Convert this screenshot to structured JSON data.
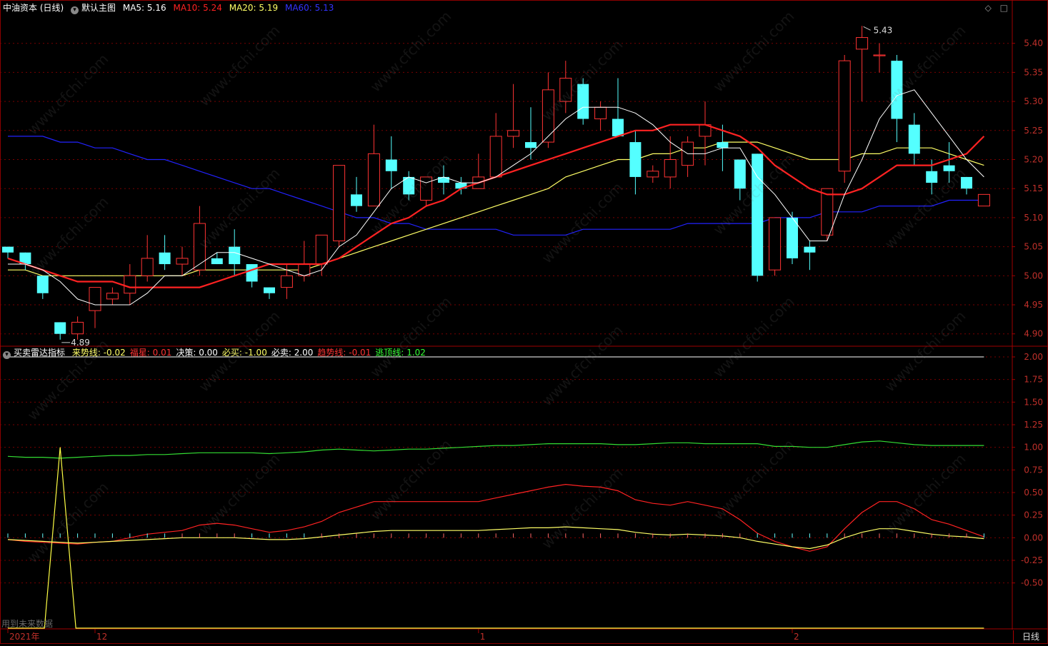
{
  "main_header": {
    "stock": "中油资本 (日线)",
    "template": "默认主图",
    "ma5": "MA5: 5.16",
    "ma10": "MA10: 5.24",
    "ma20": "MA20: 5.19",
    "ma60": "MA60: 5.13"
  },
  "indicator_header": {
    "name": "买卖雷达指标",
    "items": [
      {
        "text": "来势线: -0.02",
        "color": "#ffff66"
      },
      {
        "text": "福星: 0.01",
        "color": "#ff3333"
      },
      {
        "text": "决策: 0.00",
        "color": "#ffffff"
      },
      {
        "text": "必买: -1.00",
        "color": "#ffff66"
      },
      {
        "text": "必卖: 2.00",
        "color": "#ffffff"
      },
      {
        "text": "趋势线: -0.01",
        "color": "#ff3333"
      },
      {
        "text": "逃顶线: 1.02",
        "color": "#33ff33"
      }
    ]
  },
  "top_icons": [
    "diamond-icon",
    "square-icon"
  ],
  "watermark": "www.cfchi.com",
  "future_note": "用到未来数据",
  "period_button": "日线",
  "x_labels": [
    {
      "text": "2021年",
      "idx": 0
    },
    {
      "text": "12",
      "idx": 5
    },
    {
      "text": "1",
      "idx": 27
    },
    {
      "text": "2",
      "idx": 45
    }
  ],
  "price_axis": {
    "ticks": [
      5.4,
      5.35,
      5.3,
      5.25,
      5.2,
      5.15,
      5.1,
      5.05,
      5.0,
      4.95,
      4.9
    ],
    "min": 4.88,
    "max": 5.45
  },
  "ind_axis": {
    "ticks": [
      "2.00",
      "1.75",
      "1.50",
      "1.25",
      "1.00",
      "0.75",
      "0.50",
      "0.25",
      "0.00",
      "-0.25",
      "-0.50"
    ],
    "min": -1.0,
    "max": 2.0
  },
  "annotations": {
    "high": "5.43",
    "low": "4.89"
  },
  "colors": {
    "up": "#ff3333",
    "down": "#54ffff",
    "ma5": "#ffffff",
    "ma10": "#ff2222",
    "ma20": "#ffff66",
    "ma60": "#2222ff",
    "grid": "#7a0000"
  },
  "chart_data": {
    "type": "candlestick",
    "candles": [
      [
        5.05,
        5.04,
        5.05,
        5.03
      ],
      [
        5.04,
        5.02,
        5.04,
        5.01
      ],
      [
        5.0,
        4.97,
        5.0,
        4.96
      ],
      [
        4.92,
        4.9,
        4.92,
        4.89
      ],
      [
        4.9,
        4.92,
        4.93,
        4.89
      ],
      [
        4.94,
        4.98,
        4.98,
        4.91
      ],
      [
        4.96,
        4.97,
        4.98,
        4.95
      ],
      [
        4.97,
        5.0,
        5.02,
        4.95
      ],
      [
        5.0,
        5.03,
        5.07,
        4.99
      ],
      [
        5.04,
        5.02,
        5.07,
        5.01
      ],
      [
        5.02,
        5.03,
        5.05,
        5.0
      ],
      [
        5.01,
        5.09,
        5.12,
        5.0
      ],
      [
        5.03,
        5.02,
        5.04,
        5.02
      ],
      [
        5.05,
        5.02,
        5.08,
        5.0
      ],
      [
        5.02,
        4.99,
        5.02,
        4.98
      ],
      [
        4.98,
        4.97,
        4.98,
        4.96
      ],
      [
        4.98,
        5.0,
        5.02,
        4.96
      ],
      [
        5.0,
        5.02,
        5.06,
        4.99
      ],
      [
        5.02,
        5.07,
        5.07,
        5.0
      ],
      [
        5.06,
        5.19,
        5.19,
        5.05
      ],
      [
        5.14,
        5.12,
        5.17,
        5.11
      ],
      [
        5.12,
        5.21,
        5.26,
        5.12
      ],
      [
        5.2,
        5.18,
        5.24,
        5.15
      ],
      [
        5.17,
        5.14,
        5.18,
        5.13
      ],
      [
        5.13,
        5.17,
        5.17,
        5.12
      ],
      [
        5.17,
        5.16,
        5.19,
        5.14
      ],
      [
        5.16,
        5.15,
        5.17,
        5.14
      ],
      [
        5.15,
        5.17,
        5.21,
        5.15
      ],
      [
        5.17,
        5.24,
        5.28,
        5.2
      ],
      [
        5.24,
        5.25,
        5.33,
        5.22
      ],
      [
        5.23,
        5.22,
        5.29,
        5.2
      ],
      [
        5.23,
        5.32,
        5.35,
        5.22
      ],
      [
        5.3,
        5.34,
        5.37,
        5.28
      ],
      [
        5.33,
        5.27,
        5.34,
        5.26
      ],
      [
        5.27,
        5.29,
        5.3,
        5.25
      ],
      [
        5.27,
        5.24,
        5.34,
        5.24
      ],
      [
        5.23,
        5.17,
        5.25,
        5.14
      ],
      [
        5.17,
        5.18,
        5.19,
        5.16
      ],
      [
        5.17,
        5.2,
        5.24,
        5.15
      ],
      [
        5.19,
        5.23,
        5.24,
        5.17
      ],
      [
        5.24,
        5.26,
        5.3,
        5.19
      ],
      [
        5.23,
        5.22,
        5.26,
        5.18
      ],
      [
        5.2,
        5.15,
        5.2,
        5.13
      ],
      [
        5.21,
        5.0,
        5.21,
        4.99
      ],
      [
        5.01,
        5.1,
        5.1,
        5.0
      ],
      [
        5.1,
        5.03,
        5.11,
        5.02
      ],
      [
        5.05,
        5.04,
        5.06,
        5.01
      ],
      [
        5.07,
        5.15,
        5.15,
        5.06
      ],
      [
        5.18,
        5.37,
        5.38,
        5.16
      ],
      [
        5.39,
        5.41,
        5.43,
        5.3
      ],
      [
        5.38,
        5.38,
        5.4,
        5.35
      ],
      [
        5.37,
        5.27,
        5.38,
        5.23
      ],
      [
        5.26,
        5.21,
        5.28,
        5.19
      ],
      [
        5.18,
        5.16,
        5.2,
        5.14
      ],
      [
        5.19,
        5.18,
        5.23,
        5.16
      ],
      [
        5.17,
        5.15,
        5.17,
        5.14
      ],
      [
        5.12,
        5.14,
        5.14,
        5.12
      ]
    ],
    "ma5": [
      5.02,
      5.02,
      5.01,
      4.99,
      4.96,
      4.95,
      4.95,
      4.95,
      4.97,
      5.0,
      5.0,
      5.02,
      5.04,
      5.04,
      5.03,
      5.02,
      5.01,
      5.0,
      5.01,
      5.05,
      5.07,
      5.11,
      5.15,
      5.17,
      5.16,
      5.17,
      5.16,
      5.16,
      5.17,
      5.19,
      5.21,
      5.24,
      5.27,
      5.29,
      5.29,
      5.29,
      5.28,
      5.26,
      5.23,
      5.21,
      5.21,
      5.22,
      5.22,
      5.17,
      5.14,
      5.1,
      5.06,
      5.06,
      5.14,
      5.2,
      5.27,
      5.31,
      5.32,
      5.28,
      5.24,
      5.2,
      5.17
    ],
    "ma10": [
      5.03,
      5.02,
      5.01,
      5.0,
      4.99,
      4.99,
      4.99,
      4.98,
      4.98,
      4.98,
      4.98,
      4.98,
      4.99,
      5.0,
      5.01,
      5.02,
      5.02,
      5.02,
      5.02,
      5.03,
      5.05,
      5.07,
      5.09,
      5.1,
      5.12,
      5.13,
      5.15,
      5.16,
      5.17,
      5.18,
      5.19,
      5.2,
      5.21,
      5.22,
      5.23,
      5.24,
      5.25,
      5.25,
      5.26,
      5.26,
      5.26,
      5.25,
      5.24,
      5.22,
      5.19,
      5.17,
      5.15,
      5.14,
      5.14,
      5.15,
      5.17,
      5.19,
      5.19,
      5.19,
      5.2,
      5.21,
      5.24
    ],
    "ma20": [
      5.01,
      5.01,
      5.0,
      5.0,
      5.0,
      5.0,
      5.0,
      5.0,
      5.0,
      5.0,
      5.0,
      5.01,
      5.01,
      5.01,
      5.01,
      5.01,
      5.01,
      5.01,
      5.02,
      5.03,
      5.04,
      5.05,
      5.06,
      5.07,
      5.08,
      5.09,
      5.1,
      5.11,
      5.12,
      5.13,
      5.14,
      5.15,
      5.17,
      5.18,
      5.19,
      5.2,
      5.2,
      5.21,
      5.21,
      5.22,
      5.22,
      5.23,
      5.23,
      5.23,
      5.22,
      5.21,
      5.2,
      5.2,
      5.2,
      5.21,
      5.21,
      5.22,
      5.22,
      5.22,
      5.21,
      5.2,
      5.19
    ],
    "ma60": [
      5.24,
      5.24,
      5.24,
      5.23,
      5.23,
      5.22,
      5.22,
      5.21,
      5.2,
      5.2,
      5.19,
      5.18,
      5.17,
      5.16,
      5.15,
      5.15,
      5.14,
      5.13,
      5.12,
      5.11,
      5.1,
      5.1,
      5.09,
      5.09,
      5.08,
      5.08,
      5.08,
      5.08,
      5.08,
      5.07,
      5.07,
      5.07,
      5.07,
      5.08,
      5.08,
      5.08,
      5.08,
      5.08,
      5.08,
      5.09,
      5.09,
      5.09,
      5.09,
      5.09,
      5.1,
      5.1,
      5.1,
      5.11,
      5.11,
      5.11,
      5.12,
      5.12,
      5.12,
      5.12,
      5.13,
      5.13,
      5.13
    ],
    "indicator": {
      "escape_top": [
        0.9,
        0.89,
        0.89,
        0.88,
        0.89,
        0.9,
        0.91,
        0.91,
        0.92,
        0.92,
        0.93,
        0.94,
        0.94,
        0.94,
        0.94,
        0.93,
        0.94,
        0.95,
        0.97,
        0.98,
        0.97,
        0.96,
        0.97,
        0.98,
        0.98,
        0.99,
        1.0,
        1.01,
        1.02,
        1.02,
        1.03,
        1.04,
        1.04,
        1.04,
        1.04,
        1.03,
        1.03,
        1.04,
        1.05,
        1.05,
        1.04,
        1.04,
        1.04,
        1.04,
        1.01,
        1.01,
        1.0,
        1.0,
        1.03,
        1.06,
        1.07,
        1.05,
        1.03,
        1.02,
        1.02,
        1.02,
        1.02
      ],
      "lucky": [
        -0.02,
        -0.04,
        -0.05,
        -0.06,
        -0.07,
        -0.05,
        -0.04,
        0.0,
        0.04,
        0.06,
        0.08,
        0.14,
        0.16,
        0.14,
        0.1,
        0.06,
        0.08,
        0.12,
        0.18,
        0.28,
        0.34,
        0.4,
        0.4,
        0.4,
        0.4,
        0.4,
        0.4,
        0.4,
        0.44,
        0.48,
        0.52,
        0.56,
        0.59,
        0.57,
        0.56,
        0.52,
        0.42,
        0.38,
        0.36,
        0.4,
        0.36,
        0.32,
        0.2,
        0.05,
        -0.04,
        -0.1,
        -0.15,
        -0.1,
        0.1,
        0.28,
        0.4,
        0.4,
        0.32,
        0.2,
        0.15,
        0.08,
        0.01
      ],
      "trend": [
        -0.02,
        -0.03,
        -0.04,
        -0.05,
        -0.06,
        -0.05,
        -0.04,
        -0.03,
        -0.02,
        -0.01,
        0.0,
        0.0,
        0.0,
        0.0,
        -0.01,
        -0.02,
        -0.02,
        -0.01,
        0.01,
        0.03,
        0.05,
        0.07,
        0.08,
        0.08,
        0.08,
        0.08,
        0.08,
        0.08,
        0.09,
        0.1,
        0.11,
        0.11,
        0.12,
        0.11,
        0.1,
        0.09,
        0.06,
        0.04,
        0.03,
        0.04,
        0.03,
        0.02,
        0.0,
        -0.04,
        -0.07,
        -0.1,
        -0.12,
        -0.08,
        0.0,
        0.06,
        0.1,
        0.1,
        0.07,
        0.04,
        0.02,
        0.01,
        -0.01
      ],
      "decision_line": 2.0,
      "must_buy_base": -1.0,
      "must_buy_spike_idx": 3,
      "must_buy_spike_val": 1.0
    }
  }
}
